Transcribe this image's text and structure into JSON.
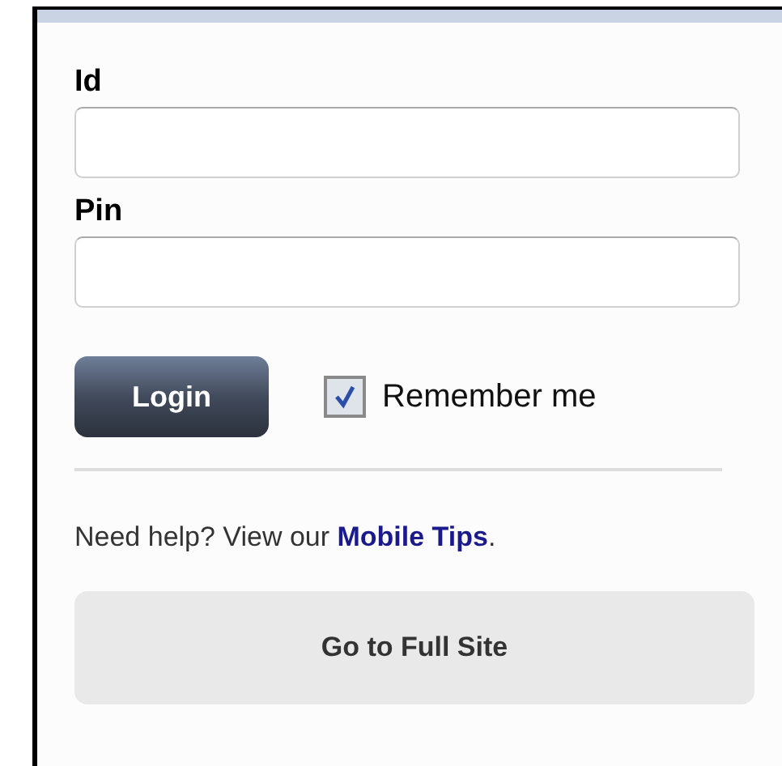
{
  "fields": [
    {
      "label": "Id"
    },
    {
      "label": "Pin"
    }
  ],
  "login_button": "Login",
  "remember": {
    "label": "Remember me",
    "checked": true
  },
  "help": {
    "prefix": "Need help? View our ",
    "link": "Mobile Tips",
    "suffix": "."
  },
  "full_site_button": "Go to Full Site"
}
